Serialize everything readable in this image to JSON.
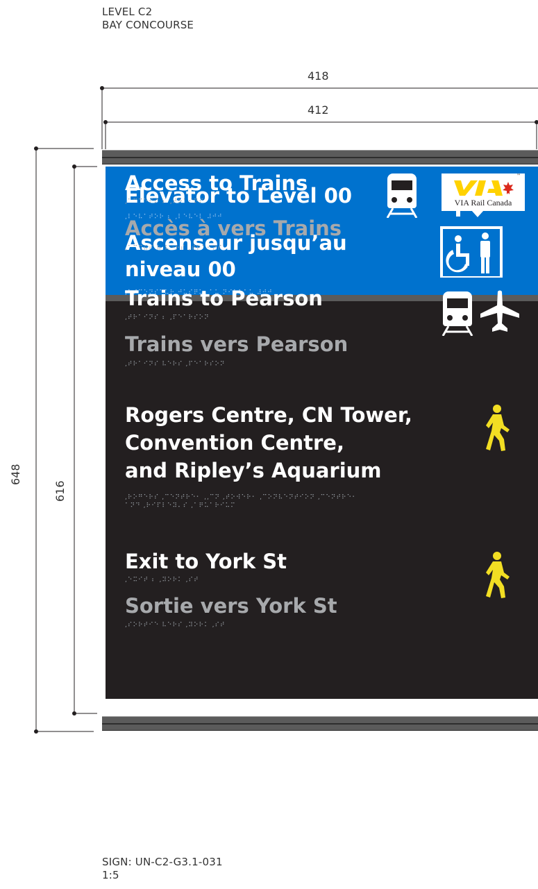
{
  "header": {
    "line1": "LEVEL C2",
    "line2": "BAY CONCOURSE"
  },
  "dimensions": {
    "outer_width": "418",
    "inner_width": "412",
    "outer_height": "648",
    "inner_height": "616"
  },
  "sign": {
    "elevator": {
      "en": "Elevator to Level 00",
      "en_braille": ",⠇⠑⠧⠁⠞⠕⠗ ⠆ ,⠇⠑⠧⠑⠇ ⠼⠚⠚",
      "fr_line1": "Ascenseur jusqu’au",
      "fr_line2": "niveau 00",
      "fr_braille": ",⠁⠎⠉⠑⠝⠎⠑⠥⠗ ⠚⠥⠎⠟⠥⠄⠁⠥ ⠝⠊⠧⠑⠁⠥ ⠼⠚⠚"
    },
    "trains": {
      "en": "Access to Trains",
      "en_braille": ",⠁⠉⠉⠑⠎⠎ ⠆ ,⠞⠗⠁⠊⠝⠎",
      "fr": "Accès à vers Trains",
      "fr_braille": ",⠁⠉⠉⠮⠎ ⠷ ⠧⠑⠗⠎ ,⠞⠗⠁⠊⠝⠎",
      "logo_text": "VIA Rail Canada",
      "logo_tm": "™",
      "logo_mark": "VIA"
    },
    "pearson": {
      "en": "Trains to Pearson",
      "en_braille": ",⠞⠗⠁⠊⠝⠎ ⠆ ,⠏⠑⠁⠗⠎⠕⠝",
      "fr": "Trains vers Pearson",
      "fr_braille": ",⠞⠗⠁⠊⠝⠎ ⠧⠑⠗⠎ ,⠏⠑⠁⠗⠎⠕⠝"
    },
    "rogers": {
      "line1": "Rogers Centre, CN Tower,",
      "line2": "Convention Centre,",
      "line3": "and Ripley’s Aquarium",
      "braille_line1": ",⠗⠕⠛⠑⠗⠎ ,⠉⠑⠝⠞⠗⠑⠂ ,,⠉⠝ ,⠞⠕⠺⠑⠗⠂ ,⠉⠕⠝⠧⠑⠝⠞⠊⠕⠝ ,⠉⠑⠝⠞⠗⠑⠂",
      "braille_line2": "⠁⠝⠙ ,⠗⠊⠏⠇⠑⠽⠄⠎ ,⠁⠟⠥⠁⠗⠊⠥⠍"
    },
    "york": {
      "en": "Exit to York St",
      "en_braille": ",⠑⠭⠊⠞ ⠆ ,⠽⠕⠗⠅ ,⠎⠞",
      "fr": "Sortie vers York St",
      "fr_braille": ",⠎⠕⠗⠞⠊⠑ ⠧⠑⠗⠎ ,⠽⠕⠗⠅ ,⠎⠞"
    }
  },
  "footer": {
    "line1": "SIGN: UN-C2-G3.1-031",
    "line2": "1:5"
  },
  "colors": {
    "blue": "#0072ce",
    "panel": "#231f20",
    "rail": "#5b5b5b",
    "walk": "#f2de23",
    "via_yellow": "#ffd200",
    "via_red": "#da291c"
  },
  "icons": [
    "up-arrow-icon",
    "down-arrow-icon",
    "accessible-elevator-icon",
    "train-icon",
    "via-rail-logo",
    "airplane-icon",
    "walking-person-icon"
  ]
}
